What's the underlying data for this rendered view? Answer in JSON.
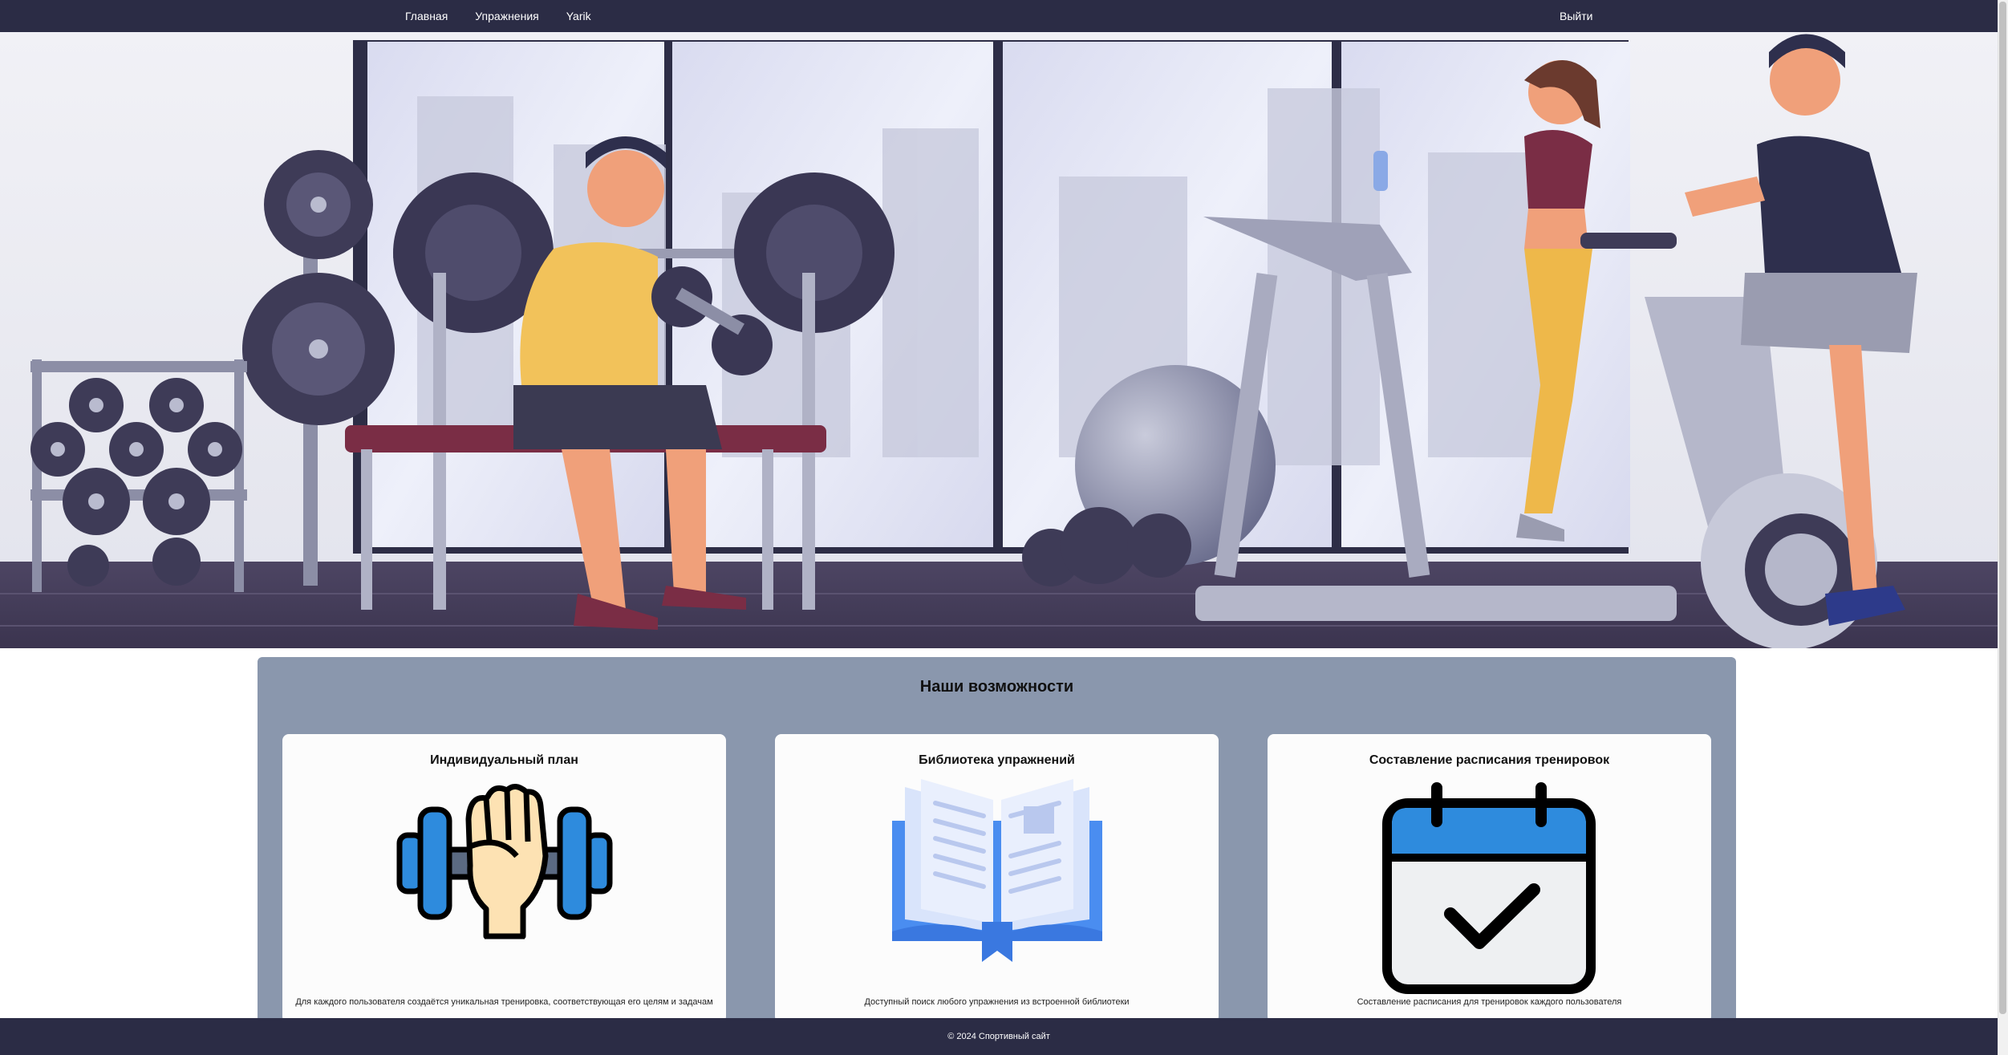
{
  "nav": {
    "items": [
      {
        "label": "Главная"
      },
      {
        "label": "Упражнения"
      },
      {
        "label": "Yarik"
      }
    ],
    "logout_label": "Выйти"
  },
  "hero": {
    "image": "gym-illustration"
  },
  "features": {
    "title": "Наши возможности",
    "cards": [
      {
        "title": "Индивидуальный план",
        "icon": "dumbbell-hand-icon",
        "text": "Для каждого пользователя создаётся уникальная тренировка, соответствующая его целям и задачам"
      },
      {
        "title": "Библиотека упражнений",
        "icon": "open-book-icon",
        "text": "Доступный поиск любого упражнения из встроенной библиотеки"
      },
      {
        "title": "Составление расписания тренировок",
        "icon": "calendar-check-icon",
        "text": "Составление расписания для тренировок каждого пользователя"
      }
    ]
  },
  "footer": {
    "copyright": "© 2024 Спортивный сайт"
  },
  "colors": {
    "nav_bg": "#2b2c45",
    "section_bg": "#8a97ad",
    "card_bg": "#fcfcfc",
    "icon_blue": "#2e8bdd",
    "icon_skin": "#fde2b3"
  }
}
